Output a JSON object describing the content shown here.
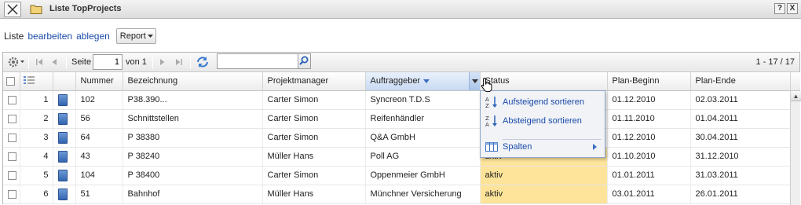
{
  "window": {
    "title": "Liste TopProjects",
    "help_label": "?",
    "close_label": "X"
  },
  "actions": {
    "list_label": "Liste",
    "edit_link": "bearbeiten",
    "file_link": "ablegen",
    "report_button": "Report"
  },
  "paging": {
    "page_label": "Seite",
    "page_value": "1",
    "of_label": "von 1",
    "search_value": "",
    "range_text": "1 - 17 / 17"
  },
  "columns": {
    "nummer": "Nummer",
    "bezeichnung": "Bezeichnung",
    "projektmanager": "Projektmanager",
    "auftraggeber": "Auftraggeber",
    "status": "Status",
    "plan_beginn": "Plan-Beginn",
    "plan_ende": "Plan-Ende"
  },
  "rows": [
    {
      "n": "1",
      "nummer": "102",
      "bez": "P38.390...",
      "pm": "Carter Simon",
      "ag": "Syncreon T.D.S",
      "status": "",
      "beginn": "01.12.2010",
      "ende": "02.03.2011"
    },
    {
      "n": "2",
      "nummer": "56",
      "bez": "Schnittstellen",
      "pm": "Carter Simon",
      "ag": "Reifenhändler",
      "status": "",
      "beginn": "01.11.2010",
      "ende": "01.04.2011"
    },
    {
      "n": "3",
      "nummer": "64",
      "bez": "P 38380",
      "pm": "Carter Simon",
      "ag": "Q&A GmbH",
      "status": "",
      "beginn": "01.12.2010",
      "ende": "30.04.2011"
    },
    {
      "n": "4",
      "nummer": "43",
      "bez": "P 38240",
      "pm": "Müller Hans",
      "ag": "Poll AG",
      "status": "aktiv",
      "beginn": "01.10.2010",
      "ende": "31.12.2010"
    },
    {
      "n": "5",
      "nummer": "104",
      "bez": "P 38400",
      "pm": "Carter Simon",
      "ag": "Oppenmeier GmbH",
      "status": "aktiv",
      "beginn": "01.01.2011",
      "ende": "31.03.2011"
    },
    {
      "n": "6",
      "nummer": "51",
      "bez": "Bahnhof",
      "pm": "Müller Hans",
      "ag": "Münchner Versicherung",
      "status": "aktiv",
      "beginn": "03.01.2011",
      "ende": "26.01.2011"
    }
  ],
  "column_menu": {
    "sort_asc": "Aufsteigend sortieren",
    "sort_desc": "Absteigend sortieren",
    "columns": "Spalten"
  },
  "colors": {
    "status_aktiv_bg": "#fde49a",
    "link": "#1a4ba8"
  }
}
